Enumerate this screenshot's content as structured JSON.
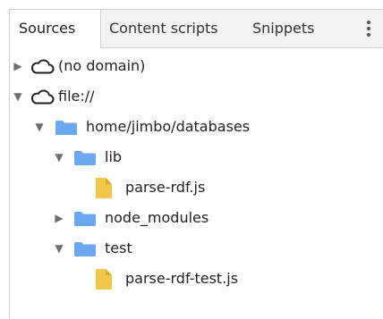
{
  "tabs": [
    {
      "label": "Sources",
      "active": true
    },
    {
      "label": "Content scripts",
      "active": false
    },
    {
      "label": "Snippets",
      "active": false
    }
  ],
  "more_menu_icon": "vertical-ellipsis-icon",
  "tree": [
    {
      "label": "(no domain)",
      "type": "domain",
      "icon": "cloud-icon",
      "expanded": false
    },
    {
      "label": "file://",
      "type": "domain",
      "icon": "cloud-icon",
      "expanded": true
    },
    {
      "label": "home/jimbo/databases",
      "type": "folder",
      "icon": "folder-icon",
      "expanded": true
    },
    {
      "label": "lib",
      "type": "folder",
      "icon": "folder-icon",
      "expanded": true
    },
    {
      "label": "parse-rdf.js",
      "type": "file",
      "icon": "js-file-icon"
    },
    {
      "label": "node_modules",
      "type": "folder",
      "icon": "folder-icon",
      "expanded": false
    },
    {
      "label": "test",
      "type": "folder",
      "icon": "folder-icon",
      "expanded": true
    },
    {
      "label": "parse-rdf-test.js",
      "type": "file",
      "icon": "js-file-icon"
    }
  ],
  "colors": {
    "folder": "#6ba8ef",
    "file": "#f2c84b",
    "file_fold": "#d9a92a",
    "tabbar_bg": "#f3f3f3",
    "border": "#cfcfcf"
  }
}
